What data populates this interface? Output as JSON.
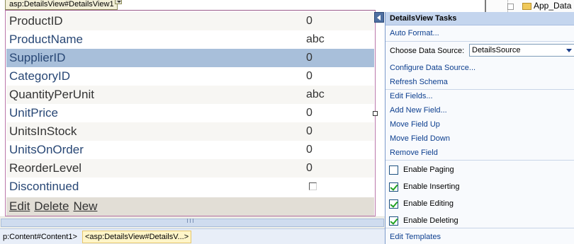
{
  "tag_label": "asp:DetailsView#DetailsView1",
  "details_view": {
    "rows": [
      {
        "field": "ProductID",
        "value": "0",
        "style": "alt",
        "link": false
      },
      {
        "field": "ProductName",
        "value": "abc",
        "style": "",
        "link": true
      },
      {
        "field": "SupplierID",
        "value": "0",
        "style": "sel",
        "link": true
      },
      {
        "field": "CategoryID",
        "value": "0",
        "style": "",
        "link": true
      },
      {
        "field": "QuantityPerUnit",
        "value": "abc",
        "style": "alt",
        "link": false
      },
      {
        "field": "UnitPrice",
        "value": "0",
        "style": "",
        "link": true
      },
      {
        "field": "UnitsInStock",
        "value": "0",
        "style": "alt",
        "link": false
      },
      {
        "field": "UnitsOnOrder",
        "value": "0",
        "style": "",
        "link": true
      },
      {
        "field": "ReorderLevel",
        "value": "0",
        "style": "alt",
        "link": false
      },
      {
        "field": "Discontinued",
        "value": "",
        "style": "",
        "link": true,
        "checkbox": true
      }
    ],
    "commands": [
      "Edit",
      "Delete",
      "New"
    ]
  },
  "tasks": {
    "title": "DetailsView Tasks",
    "auto_format": "Auto Format...",
    "choose_data_source_label": "Choose Data Source:",
    "data_source_value": "DetailsSource",
    "configure_data_source": "Configure Data Source...",
    "refresh_schema": "Refresh Schema",
    "edit_fields": "Edit Fields...",
    "add_new_field": "Add New Field...",
    "move_field_up": "Move Field Up",
    "move_field_down": "Move Field Down",
    "remove_field": "Remove Field",
    "options": [
      {
        "label": "Enable Paging",
        "checked": false
      },
      {
        "label": "Enable Inserting",
        "checked": true
      },
      {
        "label": "Enable Editing",
        "checked": true
      },
      {
        "label": "Enable Deleting",
        "checked": true
      }
    ],
    "edit_templates": "Edit Templates"
  },
  "tag_navigator": {
    "crumbs": [
      "p:Content#Content1>",
      "<asp:DetailsView#DetailsV...>"
    ]
  },
  "solution_explorer": {
    "visible_item": "App_Data"
  }
}
